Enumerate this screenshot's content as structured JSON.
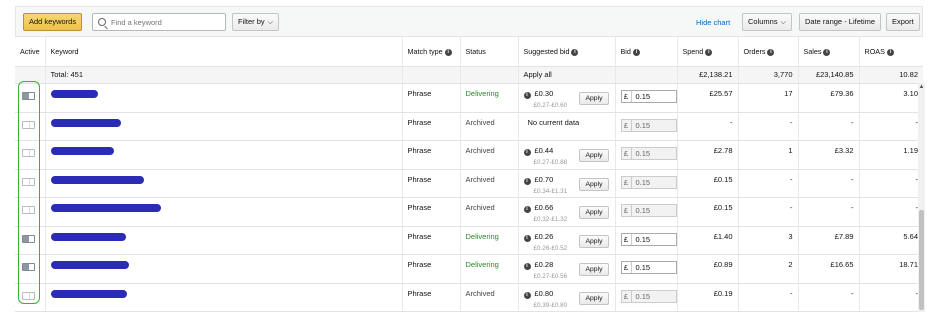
{
  "toolbar": {
    "add_keywords": "Add keywords",
    "search_placeholder": "Find a keyword",
    "filter_by": "Filter by",
    "hide_chart": "Hide chart",
    "columns": "Columns",
    "date_range": "Date range - Lifetime",
    "export": "Export"
  },
  "columns": [
    "Active",
    "Keyword",
    "Match type",
    "Status",
    "Suggested bid",
    "Bid",
    "Spend",
    "Orders",
    "Sales",
    "ROAS"
  ],
  "totals": {
    "label": "Total: 451",
    "apply_all": "Apply all",
    "spend": "£2,138.21",
    "orders": "3,770",
    "sales": "£23,140.85",
    "roas": "10.82"
  },
  "apply_label": "Apply",
  "currency_symbol": "£",
  "rows": [
    {
      "active": true,
      "match": "Phrase",
      "status": "Delivering",
      "sug": "£0.30",
      "range": "£0.27-£0.60",
      "bid": "0.15",
      "spend": "£25.57",
      "orders": "17",
      "sales": "£79.36",
      "roas": "3.10"
    },
    {
      "active": false,
      "match": "Phrase",
      "status": "Archived",
      "sug": "No current data",
      "range": "",
      "bid": "0.15",
      "spend": "-",
      "orders": "-",
      "sales": "-",
      "roas": "-"
    },
    {
      "active": false,
      "match": "Phrase",
      "status": "Archived",
      "sug": "£0.44",
      "range": "£0.27-£0.88",
      "bid": "0.15",
      "spend": "£2.78",
      "orders": "1",
      "sales": "£3.32",
      "roas": "1.19"
    },
    {
      "active": false,
      "match": "Phrase",
      "status": "Archived",
      "sug": "£0.70",
      "range": "£0.34-£1.31",
      "bid": "0.15",
      "spend": "£0.15",
      "orders": "-",
      "sales": "-",
      "roas": "-"
    },
    {
      "active": false,
      "match": "Phrase",
      "status": "Archived",
      "sug": "£0.66",
      "range": "£0.32-£1.32",
      "bid": "0.15",
      "spend": "£0.15",
      "orders": "-",
      "sales": "-",
      "roas": "-"
    },
    {
      "active": true,
      "match": "Phrase",
      "status": "Delivering",
      "sug": "£0.26",
      "range": "£0.26-£0.52",
      "bid": "0.15",
      "spend": "£1.40",
      "orders": "3",
      "sales": "£7.89",
      "roas": "5.64"
    },
    {
      "active": true,
      "match": "Phrase",
      "status": "Delivering",
      "sug": "£0.28",
      "range": "£0.27-£0.56",
      "bid": "0.15",
      "spend": "£0.89",
      "orders": "2",
      "sales": "£16.65",
      "roas": "18.71"
    },
    {
      "active": false,
      "match": "Phrase",
      "status": "Archived",
      "sug": "£0.80",
      "range": "£0.39-£0.80",
      "bid": "0.15",
      "spend": "£0.19",
      "orders": "-",
      "sales": "-",
      "roas": "-"
    }
  ],
  "colors": {
    "accent_green": "#2eb82e",
    "delivering": "#2a8a2a",
    "redaction": "#2b2bb5",
    "primary_button": "#f0c14b"
  }
}
